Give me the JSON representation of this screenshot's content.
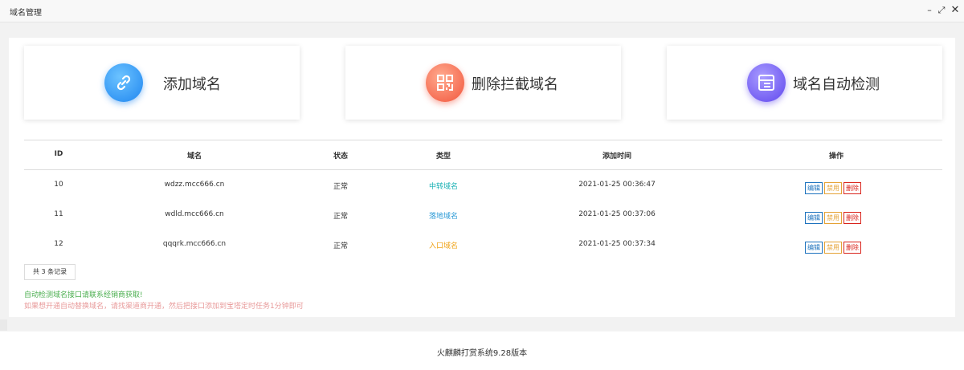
{
  "window": {
    "title": "域名管理",
    "controls": {
      "minimize": "–",
      "maximize": "⤢",
      "close": "✕"
    }
  },
  "actions": [
    {
      "label": "添加域名",
      "icon": "link-icon",
      "color": "#1f86f0"
    },
    {
      "label": "删除拦截域名",
      "icon": "qrcode-icon",
      "color": "#f2553c"
    },
    {
      "label": "域名自动检测",
      "icon": "layout-icon",
      "color": "#6047ee"
    }
  ],
  "table": {
    "headers": [
      "ID",
      "域名",
      "状态",
      "类型",
      "添加时间",
      "操作"
    ],
    "rows": [
      {
        "id": "10",
        "domain": "wdzz.mcc666.cn",
        "status": "正常",
        "type": "中转域名",
        "time": "2021-01-25 00:36:47"
      },
      {
        "id": "11",
        "domain": "wdld.mcc666.cn",
        "status": "正常",
        "type": "落地域名",
        "time": "2021-01-25 00:37:06"
      },
      {
        "id": "12",
        "domain": "qqqrk.mcc666.cn",
        "status": "正常",
        "type": "入口域名",
        "time": "2021-01-25 00:37:34"
      }
    ],
    "ops": {
      "edit": "编辑",
      "disable": "禁用",
      "delete": "删除"
    },
    "type_colors": {
      "中转域名": "#1ab1b4",
      "落地域名": "#2a9ad6",
      "入口域名": "#f0a419"
    }
  },
  "records": "共 3 条记录",
  "notes": {
    "line1": "自动检测域名接口请联系经销商获取!",
    "line2": "如果想开通自动替换域名，请找渠道商开通，然后把接口添加到宝塔定时任务1分钟即可"
  },
  "footer": "火麒麟打赏系统9.28版本"
}
